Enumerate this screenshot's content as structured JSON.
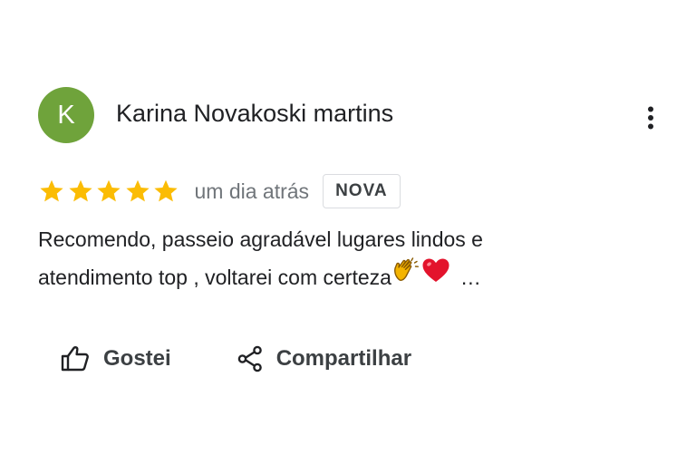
{
  "review": {
    "avatar_initial": "K",
    "author_name": "Karina Novakoski martins",
    "rating": 5,
    "max_rating": 5,
    "time_ago": "um dia atrás",
    "badge": "NOVA",
    "text_line1": "Recomendo, passeio agradável lugares lindos e",
    "text_line2": "atendimento top , voltarei com certeza",
    "truncation": "…"
  },
  "actions": {
    "like_label": "Gostei",
    "share_label": "Compartilhar"
  },
  "icons": {
    "more": "more-vert-icon",
    "star": "star-icon",
    "like": "thumb-up-icon",
    "share": "share-icon",
    "emoji_1": "clapping-hands-emoji",
    "emoji_2": "red-heart-emoji"
  },
  "colors": {
    "avatar_bg": "#6fa33b",
    "star": "#fbbc04",
    "secondary_text": "#70757a",
    "primary_text": "#202124"
  }
}
